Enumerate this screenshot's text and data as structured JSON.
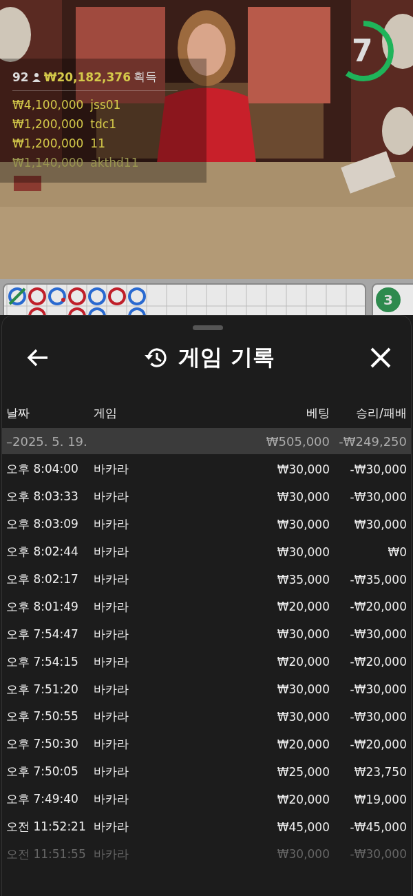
{
  "video": {
    "kind": "picture",
    "winners": {
      "count": "92",
      "total": "₩20,182,376",
      "label": "획득",
      "list": [
        {
          "amount": "₩4,100,000",
          "name": "jss01",
          "faded": false
        },
        {
          "amount": "₩1,200,000",
          "name": "tdc1",
          "faded": false
        },
        {
          "amount": "₩1,200,000",
          "name": "11",
          "faded": false
        },
        {
          "amount": "₩1,140,000",
          "name": "akthd11",
          "faded": true
        }
      ]
    },
    "timer": {
      "value": "7",
      "level": 0.6
    }
  },
  "roadmap": {
    "badge": "3"
  },
  "sheet": {
    "title": "게임 기록",
    "columns": [
      "날짜",
      "게임",
      "베팅",
      "승리/패배"
    ],
    "summary": {
      "date": "–2025. 5. 19.",
      "bet": "₩505,000",
      "result": "-₩249,250"
    },
    "rows": [
      {
        "time": "오후 8:04:00",
        "game": "바카라",
        "bet": "₩30,000",
        "result": "-₩30,000",
        "faded": false
      },
      {
        "time": "오후 8:03:33",
        "game": "바카라",
        "bet": "₩30,000",
        "result": "-₩30,000",
        "faded": false
      },
      {
        "time": "오후 8:03:09",
        "game": "바카라",
        "bet": "₩30,000",
        "result": "₩30,000",
        "faded": false
      },
      {
        "time": "오후 8:02:44",
        "game": "바카라",
        "bet": "₩30,000",
        "result": "₩0",
        "faded": false
      },
      {
        "time": "오후 8:02:17",
        "game": "바카라",
        "bet": "₩35,000",
        "result": "-₩35,000",
        "faded": false
      },
      {
        "time": "오후 8:01:49",
        "game": "바카라",
        "bet": "₩20,000",
        "result": "-₩20,000",
        "faded": false
      },
      {
        "time": "오후 7:54:47",
        "game": "바카라",
        "bet": "₩30,000",
        "result": "-₩30,000",
        "faded": false
      },
      {
        "time": "오후 7:54:15",
        "game": "바카라",
        "bet": "₩20,000",
        "result": "-₩20,000",
        "faded": false
      },
      {
        "time": "오후 7:51:20",
        "game": "바카라",
        "bet": "₩30,000",
        "result": "-₩30,000",
        "faded": false
      },
      {
        "time": "오후 7:50:55",
        "game": "바카라",
        "bet": "₩30,000",
        "result": "-₩30,000",
        "faded": false
      },
      {
        "time": "오후 7:50:30",
        "game": "바카라",
        "bet": "₩20,000",
        "result": "-₩20,000",
        "faded": false
      },
      {
        "time": "오후 7:50:05",
        "game": "바카라",
        "bet": "₩25,000",
        "result": "₩23,750",
        "faded": false
      },
      {
        "time": "오후 7:49:40",
        "game": "바카라",
        "bet": "₩20,000",
        "result": "₩19,000",
        "faded": false
      },
      {
        "time": "오전 11:52:21",
        "game": "바카라",
        "bet": "₩45,000",
        "result": "-₩45,000",
        "faded": false
      },
      {
        "time": "오전 11:51:55",
        "game": "바카라",
        "bet": "₩30,000",
        "result": "-₩30,000",
        "faded": true
      }
    ]
  }
}
